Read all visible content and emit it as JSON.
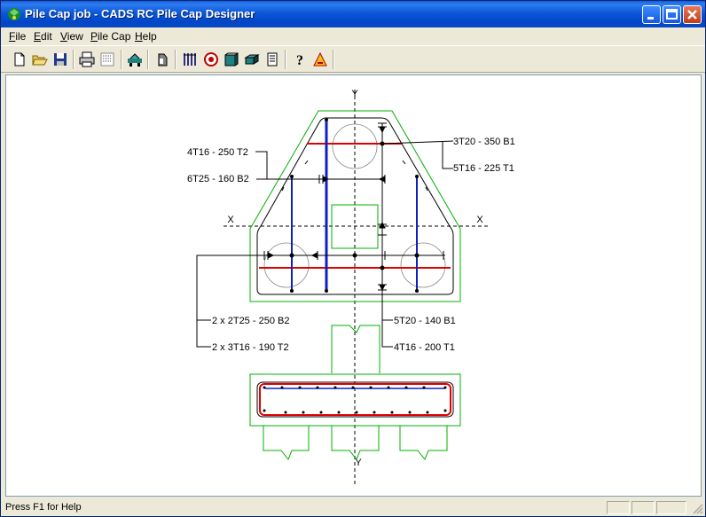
{
  "window": {
    "title": "Pile Cap job - CADS RC Pile Cap Designer"
  },
  "menu": [
    "File",
    "Edit",
    "View",
    "Pile Cap",
    "Help"
  ],
  "toolbar": {
    "buttons": [
      "new-file-icon",
      "open-folder-icon",
      "save-icon",
      "print-icon",
      "print-preview-icon",
      "pile-layout-icon",
      "cap-shape-icon",
      "bars-icon",
      "loads-icon",
      "design-icon",
      "3d-view-icon",
      "report-icon",
      "help-icon",
      "about-icon"
    ]
  },
  "drawing": {
    "axis_y_top": "Y",
    "axis_y_bottom": "Y",
    "axis_x_left": "X",
    "axis_x_right": "X",
    "labels": {
      "bar_3T20": "3T20 - 350 B1",
      "bar_5T16_225": "5T16 - 225 T1",
      "bar_4T16_250": "4T16 - 250 T2",
      "bar_6T25": "6T25 - 160 B2",
      "bar_2x2T25": "2 x 2T25 - 250 B2",
      "bar_2x3T16": "2 x 3T16 - 190 T2",
      "bar_5T20": "5T20 - 140 B1",
      "bar_4T16_200": "4T16 - 200 T1"
    },
    "colors": {
      "outline": "#00b000",
      "bottom_bar": "#e00000",
      "top_bar": "#0000c0"
    }
  },
  "status": {
    "text": "Press F1 for Help"
  }
}
